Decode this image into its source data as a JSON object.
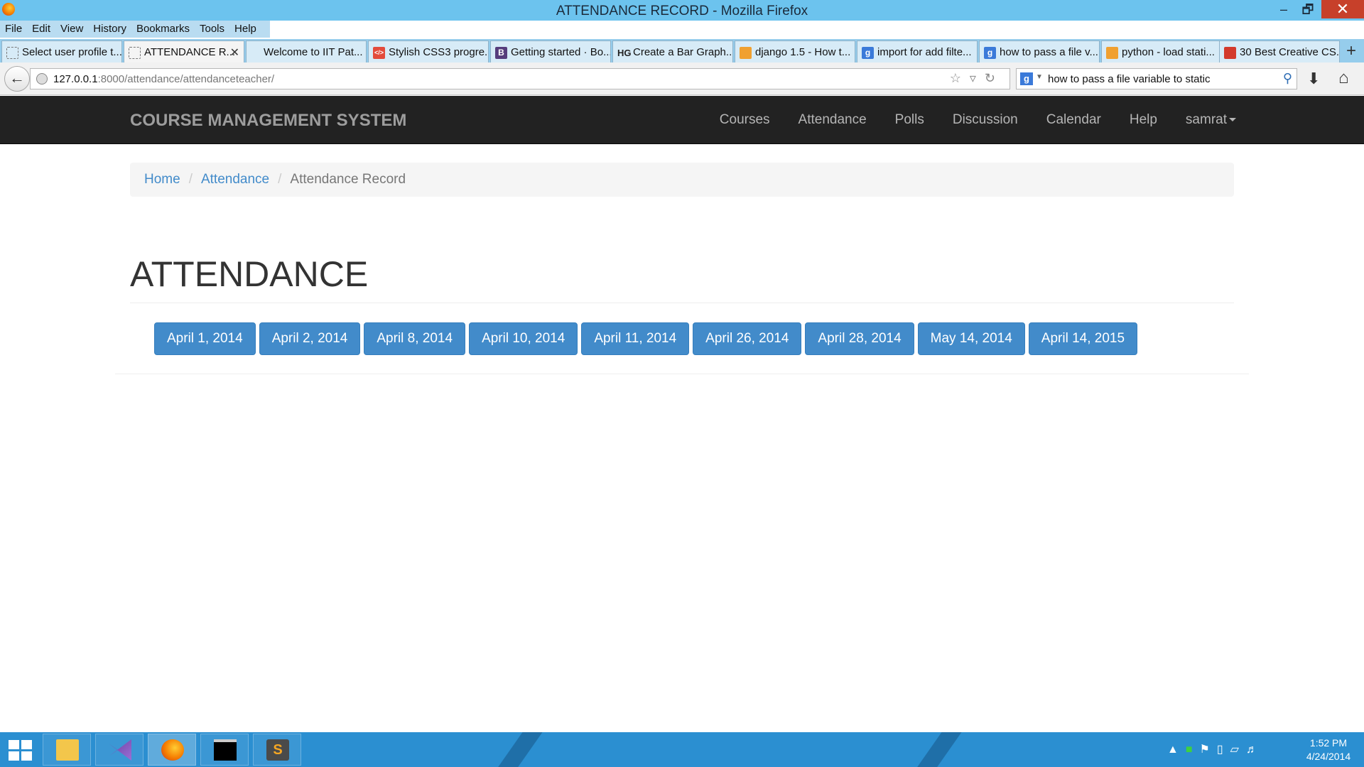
{
  "window": {
    "title": "ATTENDANCE RECORD - Mozilla Firefox",
    "minimize": "–",
    "maximize": "🗗",
    "close": "✕"
  },
  "menu": [
    "File",
    "Edit",
    "View",
    "History",
    "Bookmarks",
    "Tools",
    "Help"
  ],
  "tabs": [
    {
      "label": "Select user profile t...",
      "icon": "blank-page-icon"
    },
    {
      "label": "ATTENDANCE R...",
      "icon": "blank-page-icon",
      "active": true,
      "close": "✕"
    },
    {
      "label": "Welcome to IIT Pat...",
      "icon": "none"
    },
    {
      "label": "Stylish CSS3 progre...",
      "icon": "code-icon",
      "icon_text": "</>"
    },
    {
      "label": "Getting started · Bo...",
      "icon": "bootstrap-icon",
      "icon_text": "B"
    },
    {
      "label": "Create a Bar Graph...",
      "icon": "hg-icon",
      "icon_text": "HG"
    },
    {
      "label": "django 1.5 - How t...",
      "icon": "stackoverflow-icon"
    },
    {
      "label": "import for add filte...",
      "icon": "google-icon",
      "icon_text": "g"
    },
    {
      "label": "how to pass a file v...",
      "icon": "google-icon",
      "icon_text": "g"
    },
    {
      "label": "python - load stati...",
      "icon": "stackoverflow-icon"
    },
    {
      "label": "30 Best Creative CS...",
      "icon": "site-icon"
    }
  ],
  "new_tab": "+",
  "urlbar": {
    "host": "127.0.0.1",
    "path": ":8000/attendance/attendanceteacher/"
  },
  "searchbar": {
    "engine": "g",
    "value": "how to pass a file variable to static"
  },
  "app": {
    "brand": "COURSE MANAGEMENT SYSTEM",
    "nav": [
      "Courses",
      "Attendance",
      "Polls",
      "Discussion",
      "Calendar",
      "Help",
      "samrat"
    ]
  },
  "breadcrumb": {
    "home": "Home",
    "attendance": "Attendance",
    "current": "Attendance Record",
    "separator": "/"
  },
  "page_title": "ATTENDANCE",
  "dates": [
    "April 1, 2014",
    "April 2, 2014",
    "April 8, 2014",
    "April 10, 2014",
    "April 11, 2014",
    "April 26, 2014",
    "April 28, 2014",
    "May 14, 2014",
    "April 14, 2015"
  ],
  "taskbar": {
    "time": "1:52 PM",
    "date": "4/24/2014"
  },
  "colors": {
    "navbar": "#222222",
    "primary": "#428bca",
    "taskbar": "#2b8fd1",
    "titlebar": "#6cc3ee"
  }
}
